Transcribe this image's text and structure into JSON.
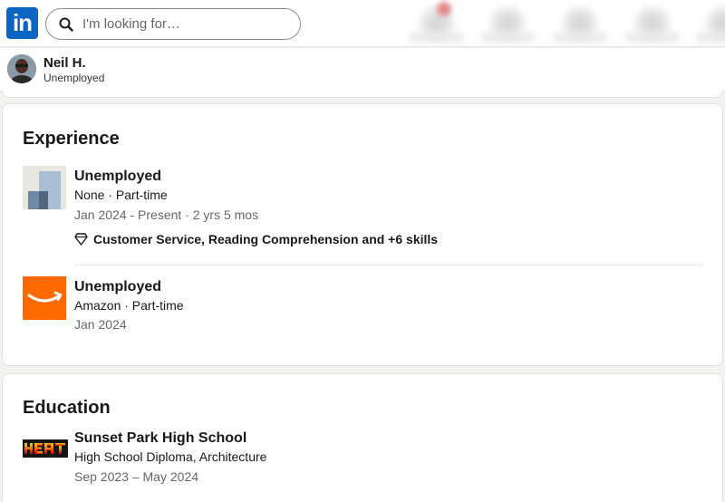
{
  "nav": {
    "logo_text": "in",
    "search_placeholder": "I'm looking for…"
  },
  "profile": {
    "name": "Neil H.",
    "headline": "Unemployed"
  },
  "experience": {
    "title": "Experience",
    "items": [
      {
        "title": "Unemployed",
        "company": "None · Part-time",
        "dates": "Jan 2024 - Present · 2 yrs 5 mos",
        "skills": "Customer Service, Reading Comprehension and +6 skills",
        "logo_icon": "generic-company-icon"
      },
      {
        "title": "Unemployed",
        "company": "Amazon · Part-time",
        "dates": "Jan 2024",
        "logo_icon": "amazon-logo-icon"
      }
    ]
  },
  "education": {
    "title": "Education",
    "items": [
      {
        "school": "Sunset Park High School",
        "degree": "High School Diploma, Architecture",
        "dates": "Sep 2023 – May 2024",
        "logo_icon": "heat-logo-icon"
      }
    ]
  },
  "colors": {
    "brand_blue": "#0a66c2",
    "amazon_orange": "#ff6a00"
  }
}
